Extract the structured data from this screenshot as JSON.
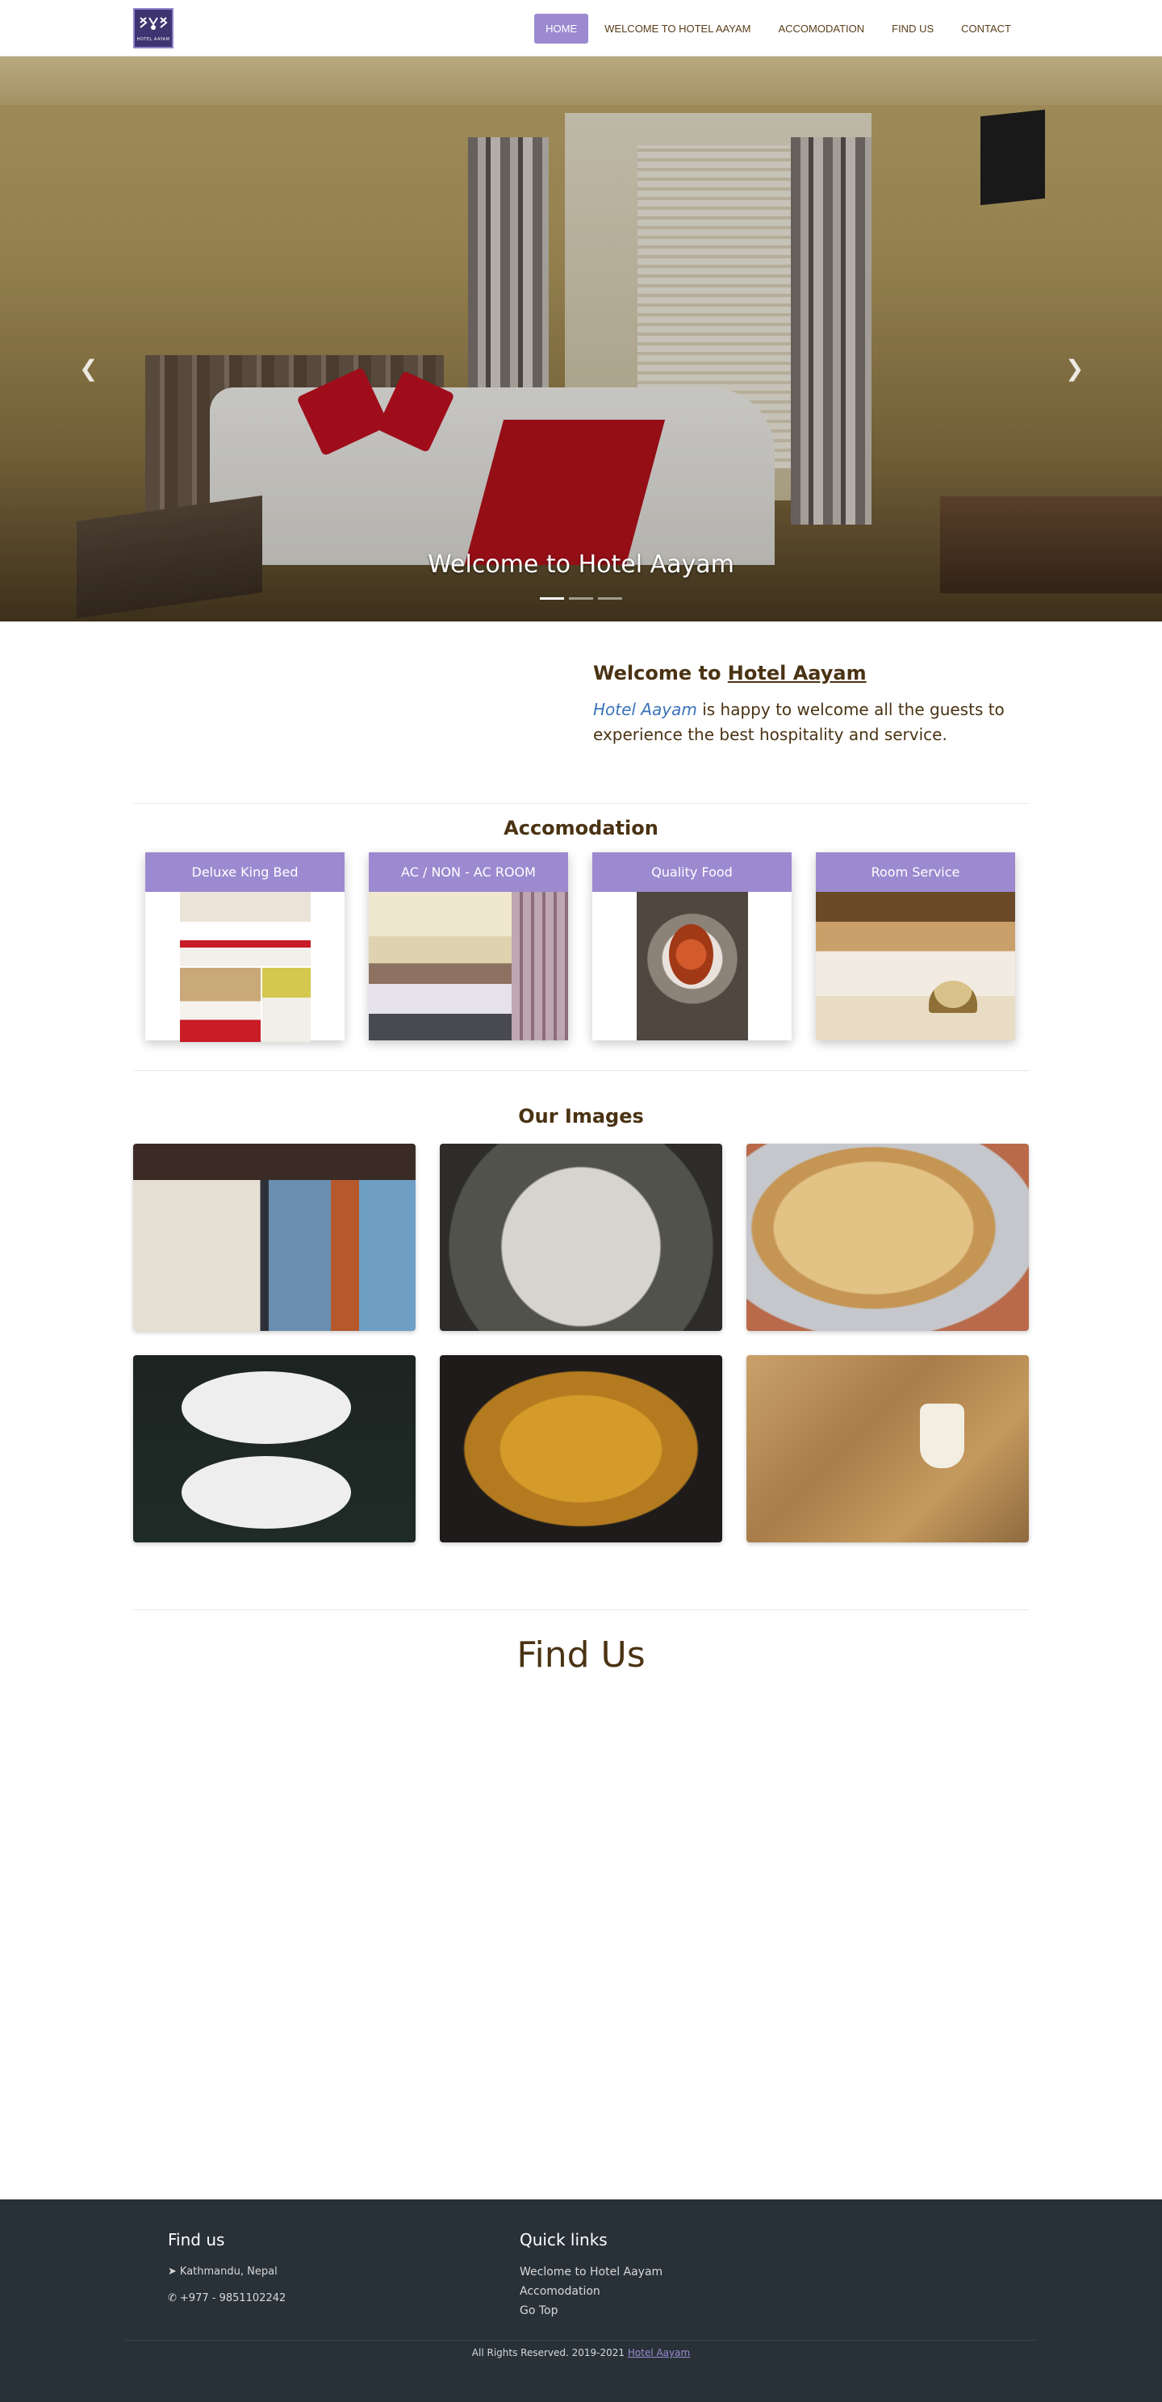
{
  "nav": {
    "logo_alt": "HOTEL AAYAM",
    "items": [
      {
        "label": "HOME",
        "active": true
      },
      {
        "label": "WELCOME TO HOTEL AAYAM",
        "active": false
      },
      {
        "label": "ACCOMODATION",
        "active": false
      },
      {
        "label": "FIND US",
        "active": false
      },
      {
        "label": "CONTACT",
        "active": false
      }
    ]
  },
  "hero": {
    "caption": "Welcome to Hotel Aayam",
    "slides": 3,
    "active_slide": 1,
    "prev_icon": "chevron-left-icon",
    "next_icon": "chevron-right-icon"
  },
  "welcome": {
    "heading_prefix": "Welcome to ",
    "heading_link": "Hotel Aayam",
    "body_em": "Hotel Aayam",
    "body_rest": " is happy to welcome all the guests to experience the best hospitality and service."
  },
  "accomodation": {
    "title": "Accomodation",
    "cards": [
      {
        "label": "Deluxe King Bed"
      },
      {
        "label": "AC / NON - AC ROOM"
      },
      {
        "label": "Quality Food"
      },
      {
        "label": "Room Service"
      }
    ]
  },
  "images": {
    "title": "Our Images"
  },
  "findus": {
    "title": "Find Us"
  },
  "footer": {
    "findus_title": "Find us",
    "location": "Kathmandu, Nepal",
    "phone": "+977 - 9851102242",
    "quicklinks_title": "Quick links",
    "links": [
      "Weclome to Hotel Aayam",
      "Accomodation",
      "Go Top"
    ],
    "copyright": "All Rights Reserved. 2019-2021",
    "copyright_link": "Hotel Aayam"
  },
  "colors": {
    "accent": "#9b8ad0",
    "text": "#4a3313",
    "footer_bg": "#283138",
    "link_blue": "#3b73b9"
  }
}
